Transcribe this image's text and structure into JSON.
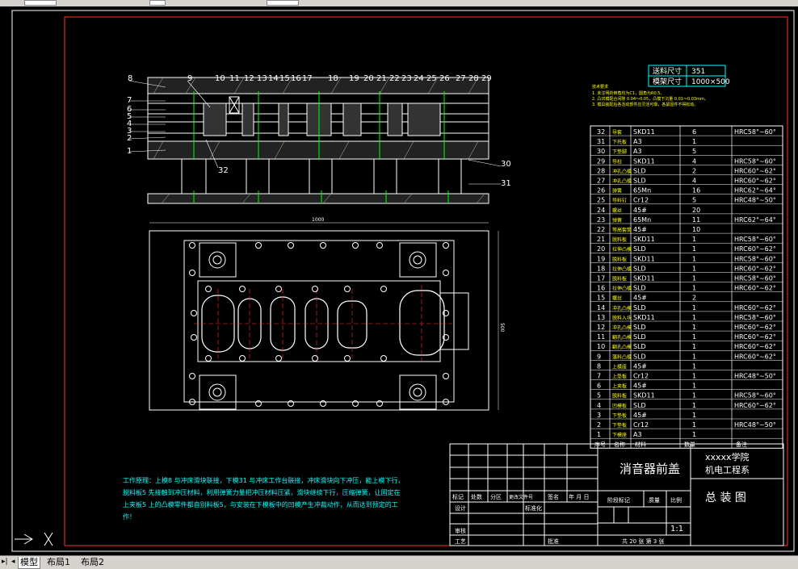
{
  "tabs": [
    {
      "label": "模型",
      "active": true
    },
    {
      "label": "布局1",
      "active": false
    },
    {
      "label": "布局2",
      "active": false
    }
  ],
  "colors": {
    "border": "#ff3030",
    "frame": "#ffffff",
    "part": "#ffffff",
    "centerline": "#ff3030",
    "cyan": "#00ffff",
    "yellow": "#ffff00",
    "green": "#00ff00",
    "bg": "#000000"
  },
  "parts_top": [
    "8",
    "9",
    "10",
    "11",
    "12",
    "13",
    "14",
    "15",
    "16",
    "17",
    "18",
    "19",
    "20",
    "21",
    "22",
    "23",
    "24",
    "25",
    "26",
    "27",
    "28",
    "29"
  ],
  "parts_left": [
    "7",
    "6",
    "5",
    "4",
    "3",
    "2",
    "1"
  ],
  "parts_other": [
    "32",
    "30",
    "31"
  ],
  "dim_width": "1000",
  "dim_height": "500",
  "size_box": [
    {
      "label": "送料尺寸",
      "value": "351"
    },
    {
      "label": "模架尺寸",
      "value": "1000×500"
    }
  ],
  "tech_req": {
    "title": "技术要求",
    "lines": [
      "1. 未注明的倒角均为C1，圆角为R0.5。",
      "2. 凸凹模配合间隙 0.04～0.05，凸模下沉量 0.01～0.03mm。",
      "3. 模具装配后各活动部件应灵活可靠，各紧固件不得松动。"
    ]
  },
  "bom_rows": [
    [
      "32",
      "导套",
      "SKD11",
      "6",
      "HRC58°~60°"
    ],
    [
      "31",
      "下托板",
      "A3",
      "1",
      ""
    ],
    [
      "30",
      "下垫脚",
      "A3",
      "5",
      ""
    ],
    [
      "29",
      "导柱",
      "SKD11",
      "4",
      "HRC58°~60°"
    ],
    [
      "28",
      "冲孔凸模",
      "SLD",
      "2",
      "HRC60°~62°"
    ],
    [
      "27",
      "冲孔凸模",
      "SLD",
      "4",
      "HRC60°~62°"
    ],
    [
      "26",
      "弹簧",
      "65Mn",
      "16",
      "HRC62°~64°"
    ],
    [
      "25",
      "导料钉",
      "Cr12",
      "5",
      "HRC48°~50°"
    ],
    [
      "24",
      "螺丝",
      "45#",
      "20",
      ""
    ],
    [
      "23",
      "弹簧",
      "65Mn",
      "11",
      "HRC62°~64°"
    ],
    [
      "22",
      "等高套筒",
      "45#",
      "10",
      ""
    ],
    [
      "21",
      "脱料板",
      "SKD11",
      "1",
      "HRC58°~60°"
    ],
    [
      "20",
      "拉伸凸模",
      "SLD",
      "1",
      "HRC60°~62°"
    ],
    [
      "19",
      "脱料板",
      "SKD11",
      "1",
      "HRC58°~60°"
    ],
    [
      "18",
      "拉伸凸模",
      "SLD",
      "1",
      "HRC60°~62°"
    ],
    [
      "17",
      "脱料板",
      "SKD11",
      "1",
      "HRC58°~60°"
    ],
    [
      "16",
      "拉伸凸模",
      "SLD",
      "1",
      "HRC60°~62°"
    ],
    [
      "15",
      "螺丝",
      "45#",
      "2",
      ""
    ],
    [
      "14",
      "冲孔凸模",
      "SLD",
      "1",
      "HRC60°~62°"
    ],
    [
      "13",
      "脱料入块",
      "SKD11",
      "1",
      "HRC58°~60°"
    ],
    [
      "12",
      "冲孔凸模",
      "SLD",
      "1",
      "HRC60°~62°"
    ],
    [
      "11",
      "翻孔凸模",
      "SLD",
      "1",
      "HRC60°~62°"
    ],
    [
      "10",
      "翻孔凸模",
      "SLD",
      "1",
      "HRC60°~62°"
    ],
    [
      "9",
      "落料凸模",
      "SLD",
      "1",
      "HRC60°~62°"
    ],
    [
      "8",
      "上模座",
      "45#",
      "1",
      ""
    ],
    [
      "7",
      "上垫板",
      "Cr12",
      "1",
      "HRC48°~50°"
    ],
    [
      "6",
      "上夹板",
      "45#",
      "1",
      ""
    ],
    [
      "5",
      "脱料板",
      "SKD11",
      "1",
      "HRC58°~60°"
    ],
    [
      "4",
      "凹模板",
      "SLD",
      "1",
      "HRC60°~62°"
    ],
    [
      "3",
      "下垫板",
      "45#",
      "1",
      ""
    ],
    [
      "2",
      "下垫板",
      "Cr12",
      "1",
      "HRC48°~50°"
    ],
    [
      "1",
      "下模座",
      "A3",
      "1",
      ""
    ]
  ],
  "bom_header": [
    "序号",
    "名称",
    "材料",
    "数量",
    "备注"
  ],
  "work_principle": {
    "lines": [
      "工作原理：上模8 与冲床滑块联接，下模31 与冲床工作台联接，冲床滑块向下冲压，能上模下行，",
      "脱料板5 先接触到冲压材料，利用弹簧力量把冲压材料压紧，滑块继续下行，压缩弹簧，让固定在",
      "上夹板5 上的凸模零件都自别料板5，与安装在下模板中的凹模产生冲裁动作，从而达到预定的工",
      "作！"
    ]
  },
  "title_block": {
    "part_name": "消音器前盖",
    "school": "xxxxx学院",
    "dept": "机电工程系",
    "drawing_name": "总 装 图",
    "scale": "1:1",
    "sheets": "共 20 张 第 3 张",
    "h_mark": "标记",
    "h_count": "处数",
    "h_zone": "分区",
    "h_doc": "更改文件号",
    "h_sign": "签名",
    "h_date": "年 月 日",
    "design": "设计",
    "std": "标准化",
    "stage": "阶段标记",
    "weight": "质量",
    "ratio": "比例",
    "check": "审核",
    "process": "工艺",
    "approve": "批准"
  }
}
